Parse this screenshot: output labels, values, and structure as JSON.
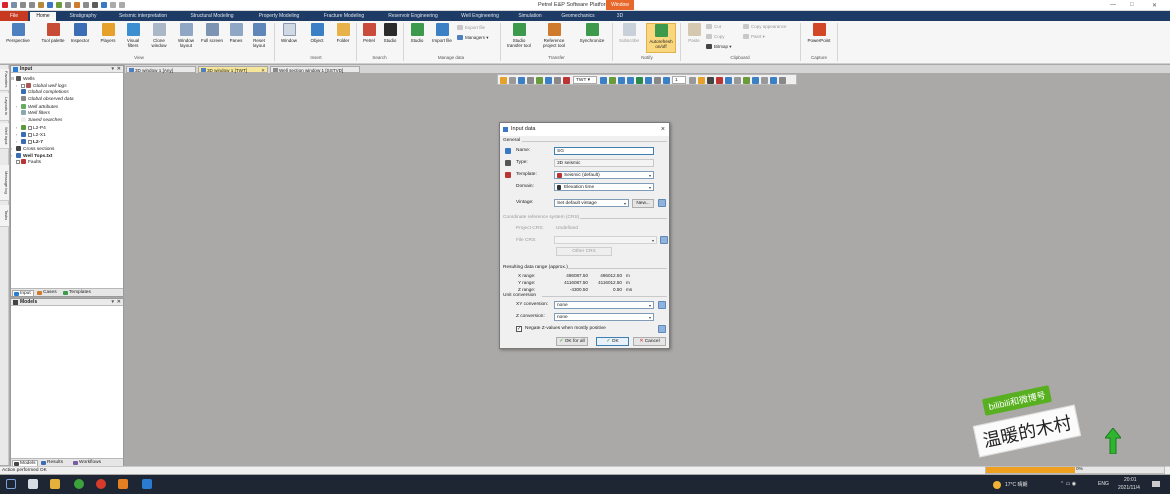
{
  "window": {
    "title": "Petrel E&P Software Platform - [Video]",
    "minimize": "—",
    "maximize": "□",
    "close": "✕"
  },
  "ribbon_tabs": {
    "file": "File",
    "home": "Home",
    "stratigraphy": "Stratigraphy",
    "seismic_interpretation": "Seismic interpretation",
    "structural_modeling": "Structural Modeling",
    "property_modeling": "Property Modeling",
    "fracture_modeling": "Fracture Modeling",
    "reservoir_engineering": "Reservoir Engineering",
    "well_engineering": "Well Engineering",
    "simulation": "Simulation",
    "geomechanics": "Geomechanics",
    "three_d": "3D",
    "context_window": "Window"
  },
  "ribbon": {
    "perspective": "Perspective",
    "tool_palette": "Tool palette",
    "inspector": "Inspector",
    "players": "Players",
    "visual_filters": "Visual filters",
    "clone_window": "Clone window",
    "window_layout": "Window layout",
    "full_screen": "Full screen",
    "panes": "Panes",
    "reset_layout": "Reset layout",
    "group_view": "View",
    "window": "Window",
    "object": "Object",
    "folder": "Folder",
    "group_insert": "Insert",
    "petrel": "Petrel",
    "studio": "Studio",
    "group_search": "Search",
    "studio2": "Studio",
    "import_file": "Import file",
    "export_file": "Export file",
    "managers": "Managers",
    "group_manage": "Manage data",
    "studio_transfer": "Studio transfer tool",
    "reference_project": "Reference project tool",
    "synchronize": "Synchronize",
    "group_transfer": "Transfer",
    "subscribe": "Subscribe",
    "autorefresh": "Autorefresh on/off",
    "group_notify": "Notify",
    "paste": "Paste",
    "cut": "Cut",
    "copy": "Copy",
    "copy_appearance": "Copy appearance",
    "paint": "Paint",
    "bitmap": "Bitmap",
    "group_clipboard": "Clipboard",
    "powerpoint": "PowerPoint",
    "group_capture": "Capture"
  },
  "side_tabs": [
    "Favorites",
    "Layouts in",
    "Well input",
    "Message log",
    "Tasks"
  ],
  "input_panel": {
    "title": "Input",
    "items": [
      {
        "label": "Wells"
      },
      {
        "label": "Global well logs"
      },
      {
        "label": "Global completions"
      },
      {
        "label": "Global observed data"
      },
      {
        "label": "Well attributes"
      },
      {
        "label": "Well filters"
      },
      {
        "label": "Saved searches"
      },
      {
        "label": "L2-P4"
      },
      {
        "label": "L2-X1"
      },
      {
        "label": "L2-7"
      },
      {
        "label": "Cross sections"
      },
      {
        "label": "Well Tops.txt"
      },
      {
        "label": "Faults"
      }
    ],
    "tabs": [
      "Input",
      "Cases",
      "Templates"
    ]
  },
  "models_panel": {
    "title": "Models",
    "tabs": [
      "Models",
      "Results",
      "Workflows"
    ]
  },
  "document_tabs": [
    {
      "label": "3D window 1 [Any]"
    },
    {
      "label": "3D window 1 [TWT]"
    },
    {
      "label": "Well section window 1 [SSTVD]"
    }
  ],
  "toolbar": {
    "domain": "TWT",
    "zoom": "1"
  },
  "dialog": {
    "title": "Input data",
    "general": "General",
    "name_label": "Name:",
    "name_value": "SG",
    "type_label": "Type:",
    "type_value": "3D seismic",
    "template_label": "Template:",
    "template_value": "Seismic (default)",
    "domain_label": "Domain:",
    "domain_value": "Elevation time",
    "vintage_label": "Vintage:",
    "vintage_value": "Set default vintage",
    "new_button": "New...",
    "crs_section": "Coordinate reference system (CRS)",
    "project_crs_label": "Project CRS:",
    "project_crs_value": "Undefined",
    "file_crs_label": "File CRS:",
    "other_crs_button": "Other CRS",
    "range_section": "Resulting data range (approx.)",
    "x_label": "X range:",
    "x_min": "486087.50",
    "x_max": "486012.50",
    "x_unit": "m",
    "y_label": "Y range:",
    "y_min": "4116087.50",
    "y_max": "4116012.50",
    "y_unit": "m",
    "z_label": "Z range:",
    "z_min": "-4300.50",
    "z_max": "0.50",
    "z_unit": "ms",
    "unit_section": "Unit conversion",
    "xy_label": "XY conversion:",
    "xy_value": "none",
    "z_conv_label": "Z conversion:",
    "z_conv_value": "none",
    "negate_label": "Negate Z-values when mostly positive",
    "ok_all": "OK for all",
    "ok": "OK",
    "cancel": "Cancel"
  },
  "status": {
    "text": "Action performed OK",
    "progress_label": "0%",
    "progress_fraction": 0.5
  },
  "taskbar": {
    "weather": "17°C 晴朗",
    "lang": "ENG",
    "time": "20:01",
    "date": "2021/11/4"
  },
  "watermark": {
    "line1": "bilibili和微博号",
    "line2": "温暖的木村"
  },
  "colors": {
    "titlebar_tabs": "#1d3b64",
    "file_tab": "#c73a21",
    "context_tab": "#e8672a",
    "active_doc_tab": "#f6e69a",
    "progress": "#f0a020",
    "taskbar": "#1e2633"
  }
}
